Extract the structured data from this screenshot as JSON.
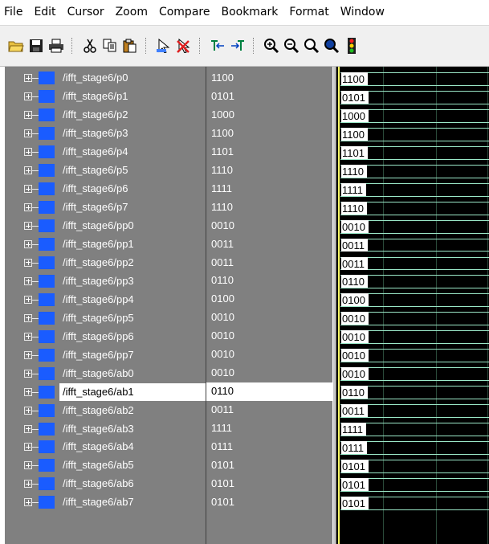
{
  "menu": [
    "File",
    "Edit",
    "Cursor",
    "Zoom",
    "Compare",
    "Bookmark",
    "Format",
    "Window"
  ],
  "toolbar": {
    "groups": [
      [
        "open-folder-icon",
        "save-icon",
        "print-icon"
      ],
      [
        "cut-icon",
        "copy-icon",
        "paste-icon"
      ],
      [
        "find-icon",
        "delete-cursor-icon"
      ],
      [
        "cursor-left-icon",
        "cursor-right-icon"
      ],
      [
        "zoom-in-icon",
        "zoom-out-icon",
        "zoom-full-icon",
        "zoom-last-icon",
        "stop-icon"
      ]
    ]
  },
  "colors": {
    "signal": "#1a5cff",
    "bus": "#9be8c8",
    "cursor": "#ffff66",
    "pane": "#808080"
  },
  "signals": [
    {
      "name": "/ifft_stage6/p0",
      "value": "1100"
    },
    {
      "name": "/ifft_stage6/p1",
      "value": "0101"
    },
    {
      "name": "/ifft_stage6/p2",
      "value": "1000"
    },
    {
      "name": "/ifft_stage6/p3",
      "value": "1100"
    },
    {
      "name": "/ifft_stage6/p4",
      "value": "1101"
    },
    {
      "name": "/ifft_stage6/p5",
      "value": "1110"
    },
    {
      "name": "/ifft_stage6/p6",
      "value": "1111"
    },
    {
      "name": "/ifft_stage6/p7",
      "value": "1110"
    },
    {
      "name": "/ifft_stage6/pp0",
      "value": "0010"
    },
    {
      "name": "/ifft_stage6/pp1",
      "value": "0011"
    },
    {
      "name": "/ifft_stage6/pp2",
      "value": "0011"
    },
    {
      "name": "/ifft_stage6/pp3",
      "value": "0110"
    },
    {
      "name": "/ifft_stage6/pp4",
      "value": "0100"
    },
    {
      "name": "/ifft_stage6/pp5",
      "value": "0010"
    },
    {
      "name": "/ifft_stage6/pp6",
      "value": "0010"
    },
    {
      "name": "/ifft_stage6/pp7",
      "value": "0010"
    },
    {
      "name": "/ifft_stage6/ab0",
      "value": "0010"
    },
    {
      "name": "/ifft_stage6/ab1",
      "value": "0110",
      "selected": true
    },
    {
      "name": "/ifft_stage6/ab2",
      "value": "0011"
    },
    {
      "name": "/ifft_stage6/ab3",
      "value": "1111"
    },
    {
      "name": "/ifft_stage6/ab4",
      "value": "0111"
    },
    {
      "name": "/ifft_stage6/ab5",
      "value": "0101"
    },
    {
      "name": "/ifft_stage6/ab6",
      "value": "0101"
    },
    {
      "name": "/ifft_stage6/ab7",
      "value": "0101"
    }
  ]
}
